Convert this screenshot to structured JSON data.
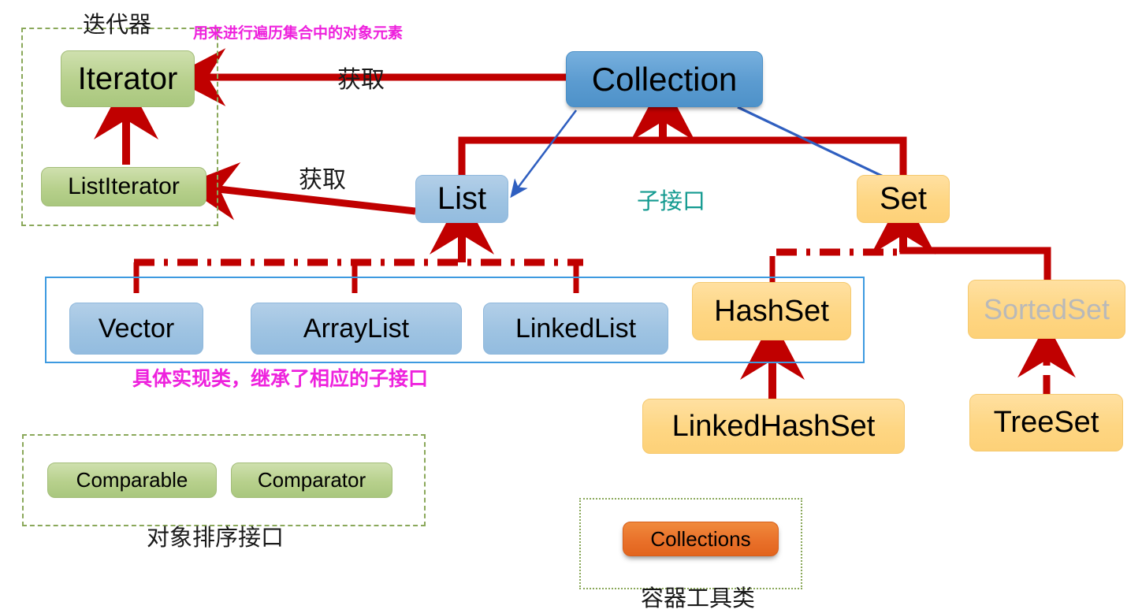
{
  "diagram": {
    "title": "Java Collection Framework Hierarchy",
    "colors": {
      "arrow_red": "#c00000",
      "arrow_blue": "#2f5fc0",
      "group_green": "#8aa85a",
      "group_blue": "#3d9ae0",
      "note_magenta": "#ee22dd",
      "note_teal": "#139a90",
      "ghost_gray": "#b9b9b9"
    },
    "nodes": {
      "iterator": "Iterator",
      "list_iterator": "ListIterator",
      "collection": "Collection",
      "list": "List",
      "set": "Set",
      "vector": "Vector",
      "array_list": "ArrayList",
      "linked_list": "LinkedList",
      "hash_set": "HashSet",
      "sorted_set": "SortedSet",
      "linked_hash_set": "LinkedHashSet",
      "tree_set": "TreeSet",
      "comparable": "Comparable",
      "comparator": "Comparator",
      "collections": "Collections"
    },
    "captions": {
      "iterator_group": "迭代器",
      "iterator_note": "用来进行遍历集合中的对象元素",
      "get_iterator": "获取",
      "get_list_iterator": "获取",
      "sub_interface": "子接口",
      "impl_note": "具体实现类，继承了相应的子接口",
      "sort_group": "对象排序接口",
      "tool_group": "容器工具类"
    }
  }
}
